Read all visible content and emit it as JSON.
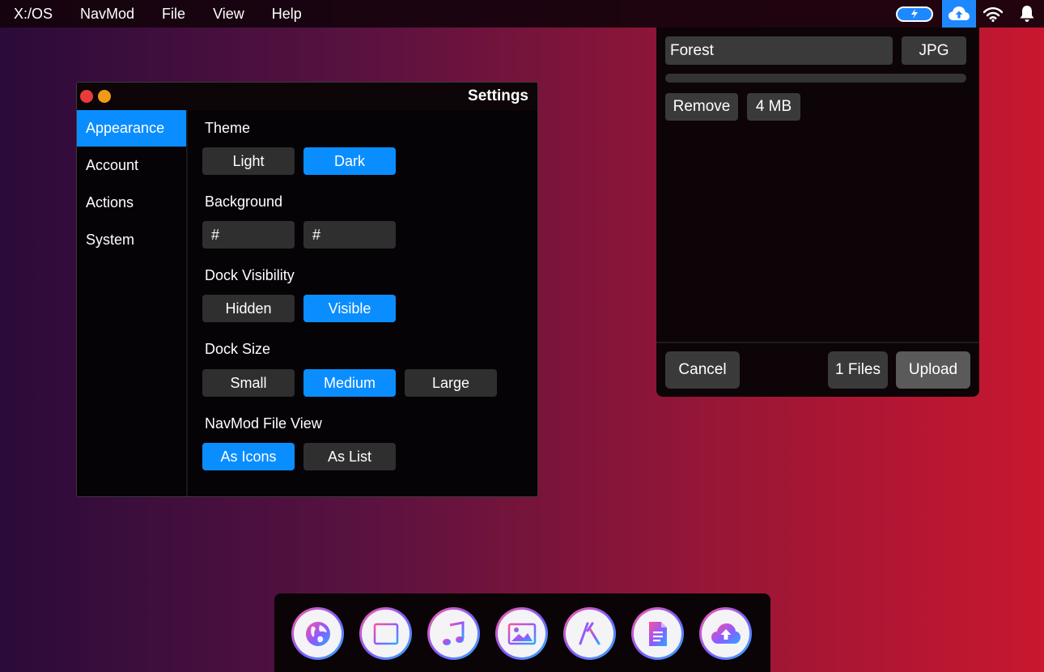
{
  "menubar": {
    "items": [
      "X:/OS",
      "NavMod",
      "File",
      "View",
      "Help"
    ],
    "tray_icons": [
      "battery-charging-icon",
      "cloud-upload-icon",
      "wifi-icon",
      "bell-icon"
    ],
    "active_tray": "cloud-upload-icon"
  },
  "settings": {
    "title": "Settings",
    "sidebar": [
      "Appearance",
      "Account",
      "Actions",
      "System"
    ],
    "active_sidebar": "Appearance",
    "theme": {
      "label": "Theme",
      "options": [
        "Light",
        "Dark"
      ],
      "selected": "Dark"
    },
    "background": {
      "label": "Background",
      "value1": "#",
      "value2": "#"
    },
    "dock_visibility": {
      "label": "Dock Visibility",
      "options": [
        "Hidden",
        "Visible"
      ],
      "selected": "Visible"
    },
    "dock_size": {
      "label": "Dock Size",
      "options": [
        "Small",
        "Medium",
        "Large"
      ],
      "selected": "Medium"
    },
    "file_view": {
      "label": "NavMod File View",
      "options": [
        "As Icons",
        "As List"
      ],
      "selected": "As Icons"
    }
  },
  "upload": {
    "file_name": "Forest",
    "extension": "JPG",
    "progress": 0,
    "remove_label": "Remove",
    "size": "4 MB",
    "cancel_label": "Cancel",
    "files_count": "1 Files",
    "upload_label": "Upload"
  },
  "dock": {
    "icons": [
      "globe-icon",
      "film-icon",
      "music-icon",
      "photos-icon",
      "app-store-icon",
      "document-icon",
      "cloud-upload-icon"
    ]
  },
  "colors": {
    "accent": "#0a8dff",
    "panel": "#060306",
    "button": "#2f2f2f"
  }
}
